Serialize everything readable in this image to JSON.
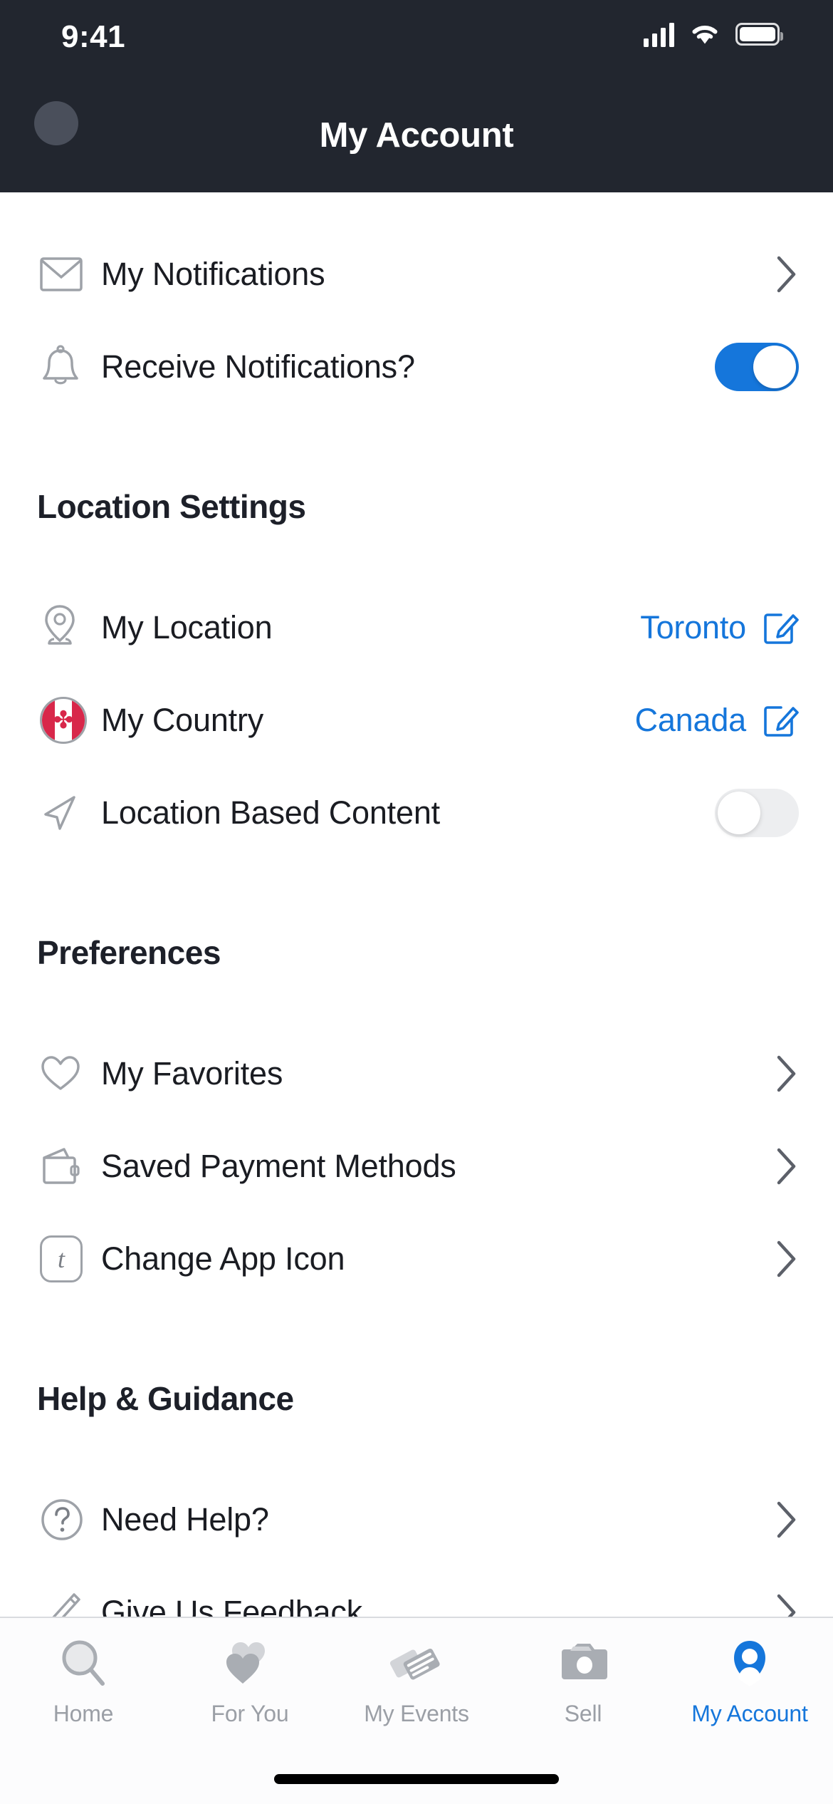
{
  "status_bar": {
    "time": "9:41",
    "signal_icon": "cellular-signal-icon",
    "wifi_icon": "wifi-icon",
    "battery_icon": "battery-icon"
  },
  "header": {
    "title": "My Account",
    "avatar_icon": "avatar",
    "background_color": "#22262F"
  },
  "theme": {
    "accent_blue": "#1576DB",
    "text_dark": "#1A1C22",
    "icon_gray": "#9EA2A8",
    "toggle_off": "#EDEEF0"
  },
  "notifications": {
    "items": [
      {
        "label": "My Notifications",
        "icon": "envelope-icon",
        "accessory": "chevron"
      },
      {
        "label": "Receive Notifications?",
        "icon": "bell-icon",
        "accessory": "toggle",
        "toggle_on": true
      }
    ]
  },
  "location_settings": {
    "title": "Location Settings",
    "items": [
      {
        "label": "My Location",
        "icon": "map-pin-icon",
        "value": "Toronto",
        "accessory": "edit"
      },
      {
        "label": "My Country",
        "icon": "canada-flag-icon",
        "value": "Canada",
        "accessory": "edit",
        "flag_leaf": "✤"
      },
      {
        "label": "Location Based Content",
        "icon": "navigation-arrow-icon",
        "accessory": "toggle",
        "toggle_on": false
      }
    ]
  },
  "preferences": {
    "title": "Preferences",
    "items": [
      {
        "label": "My Favorites",
        "icon": "heart-icon",
        "accessory": "chevron"
      },
      {
        "label": "Saved Payment Methods",
        "icon": "wallet-icon",
        "accessory": "chevron"
      },
      {
        "label": "Change App Icon",
        "icon": "app-icon-badge",
        "badge_letter": "t",
        "accessory": "chevron"
      }
    ]
  },
  "help_guidance": {
    "title": "Help & Guidance",
    "items": [
      {
        "label": "Need Help?",
        "icon": "question-circle-icon",
        "accessory": "chevron"
      },
      {
        "label": "Give Us Feedback",
        "icon": "pencil-icon",
        "accessory": "chevron"
      }
    ]
  },
  "tab_bar": {
    "tabs": [
      {
        "label": "Home",
        "icon": "magnifier-icon",
        "active": false
      },
      {
        "label": "For You",
        "icon": "hearts-icon",
        "active": false
      },
      {
        "label": "My Events",
        "icon": "tickets-icon",
        "active": false
      },
      {
        "label": "Sell",
        "icon": "camera-icon",
        "active": false
      },
      {
        "label": "My Account",
        "icon": "person-icon",
        "active": true
      }
    ]
  }
}
